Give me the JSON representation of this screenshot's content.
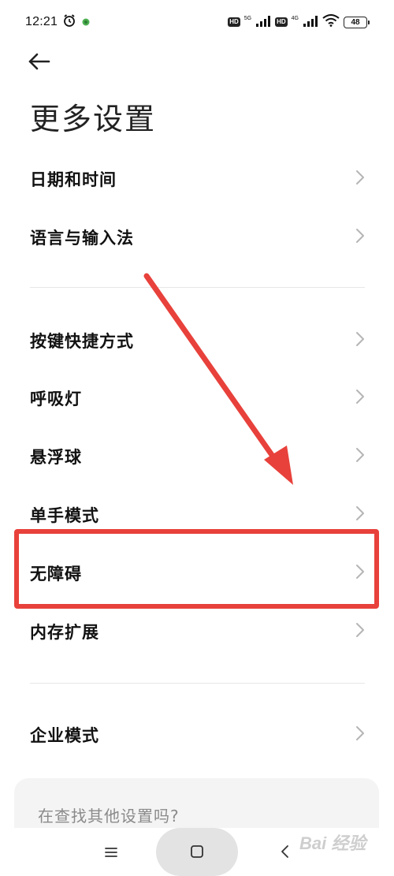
{
  "status_bar": {
    "time": "12:21",
    "net1_label": "5G",
    "net2_label": "4G",
    "hd1": "HD",
    "hd2": "HD",
    "battery": "48",
    "icons": [
      "alarm-icon",
      "notification-icon",
      "signal-icon",
      "wifi-icon",
      "battery-icon"
    ]
  },
  "header": {
    "title": "更多设置",
    "back_icon": "arrow-left-icon"
  },
  "list": {
    "items": [
      {
        "label": "日期和时间"
      },
      {
        "label": "语言与输入法"
      },
      {
        "label": "按键快捷方式"
      },
      {
        "label": "呼吸灯"
      },
      {
        "label": "悬浮球"
      },
      {
        "label": "单手模式"
      },
      {
        "label": "无障碍"
      },
      {
        "label": "内存扩展"
      },
      {
        "label": "企业模式"
      }
    ]
  },
  "search_card": {
    "text": "在查找其他设置吗?"
  },
  "nav": {
    "icons": [
      "menu-icon",
      "home-icon",
      "back-icon"
    ]
  },
  "watermark": {
    "text": "Bai 经验"
  },
  "colors": {
    "annotation_red": "#e8413b",
    "chevron": "#b5b5b5",
    "divider": "#e6e6e6"
  }
}
